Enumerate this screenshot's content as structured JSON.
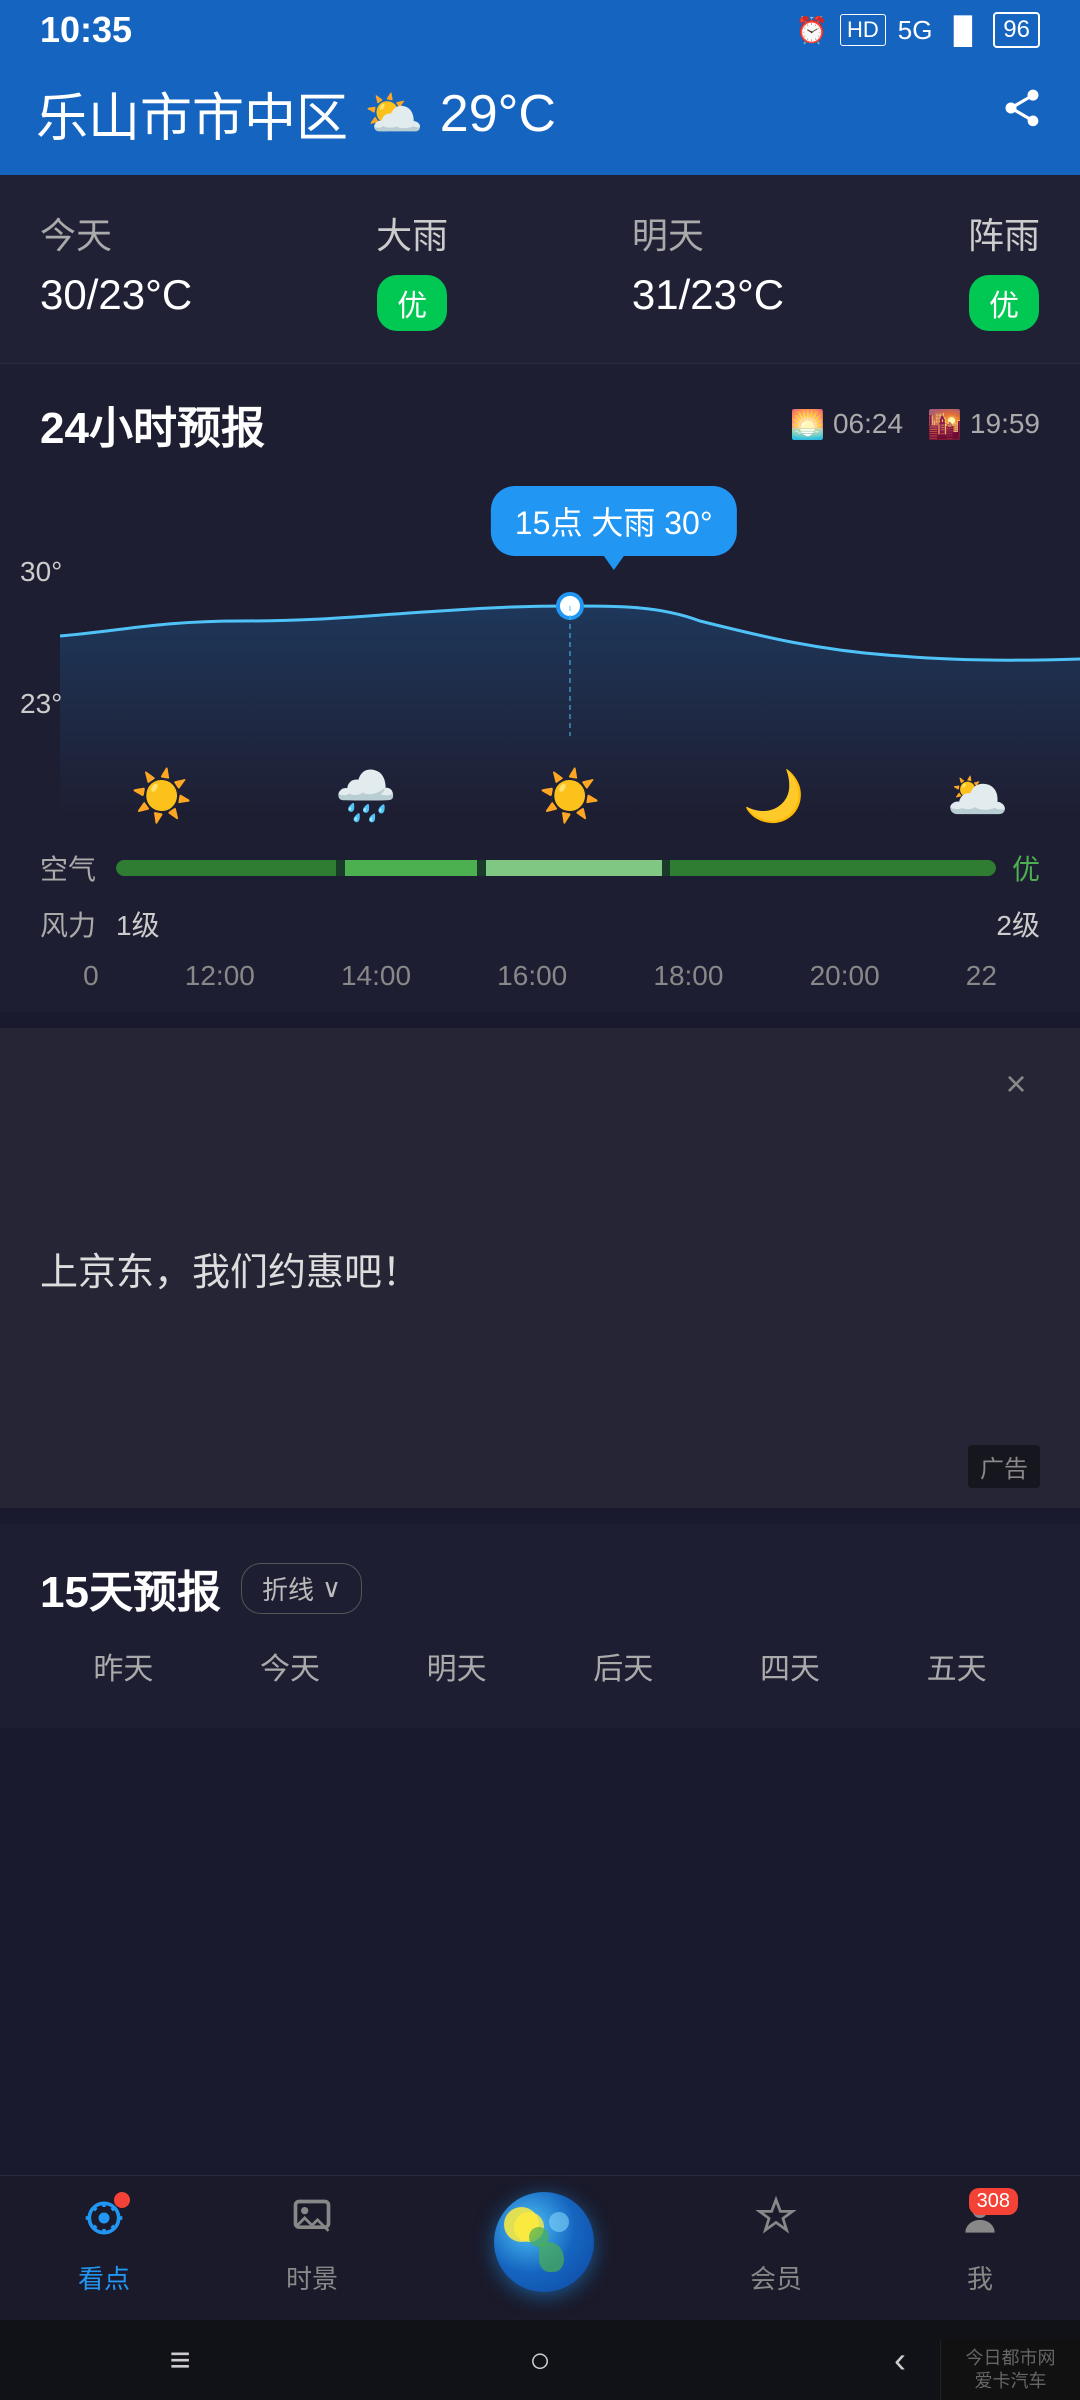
{
  "statusBar": {
    "time": "10:35",
    "battery": "96",
    "signal": "5G"
  },
  "header": {
    "city": "乐山市市中区",
    "weatherIcon": "⛅",
    "temperature": "29°C",
    "shareIconLabel": "share"
  },
  "todayWeather": {
    "todayLabel": "今天",
    "todayCondition": "大雨",
    "todayTemp": "30/23°C",
    "todayQuality": "优",
    "tomorrowLabel": "明天",
    "tomorrowCondition": "阵雨",
    "tomorrowTemp": "31/23°C",
    "tomorrowQuality": "优"
  },
  "forecast24h": {
    "title": "24小时预报",
    "sunriseTime": "06:24",
    "sunsetTime": "19:59",
    "tooltip": "15点 大雨 30°",
    "tempHigh": "30°",
    "tempLow": "23°",
    "weatherIcons": [
      "☀️",
      "🌧️",
      "☀️",
      "🌙",
      "🌥️"
    ],
    "airLabel": "空气",
    "airValue": "优",
    "windLabel": "风力",
    "windLevels": [
      "1级",
      "2级"
    ],
    "timeAxis": [
      "0",
      "12:00",
      "14:00",
      "16:00",
      "18:00",
      "20:00",
      "22"
    ]
  },
  "ad": {
    "text": "上京东，我们约惠吧！",
    "closeLabel": "×",
    "adLabel": "广告"
  },
  "forecast15": {
    "title": "15天预报",
    "toggleLabel": "折线",
    "days": [
      "昨天",
      "今天",
      "明天",
      "后天",
      "四天",
      "五天"
    ]
  },
  "bottomNav": {
    "items": [
      {
        "label": "看点",
        "icon": "◎",
        "active": true,
        "badge": "•"
      },
      {
        "label": "时景",
        "icon": "🖼",
        "active": false
      },
      {
        "label": "",
        "icon": "globe",
        "active": false,
        "center": true
      },
      {
        "label": "会员",
        "icon": "◇",
        "active": false
      },
      {
        "label": "我",
        "icon": "▣",
        "active": false,
        "badge": "308"
      }
    ]
  },
  "androidNav": {
    "menuIcon": "≡",
    "homeIcon": "○",
    "backIcon": "‹"
  }
}
